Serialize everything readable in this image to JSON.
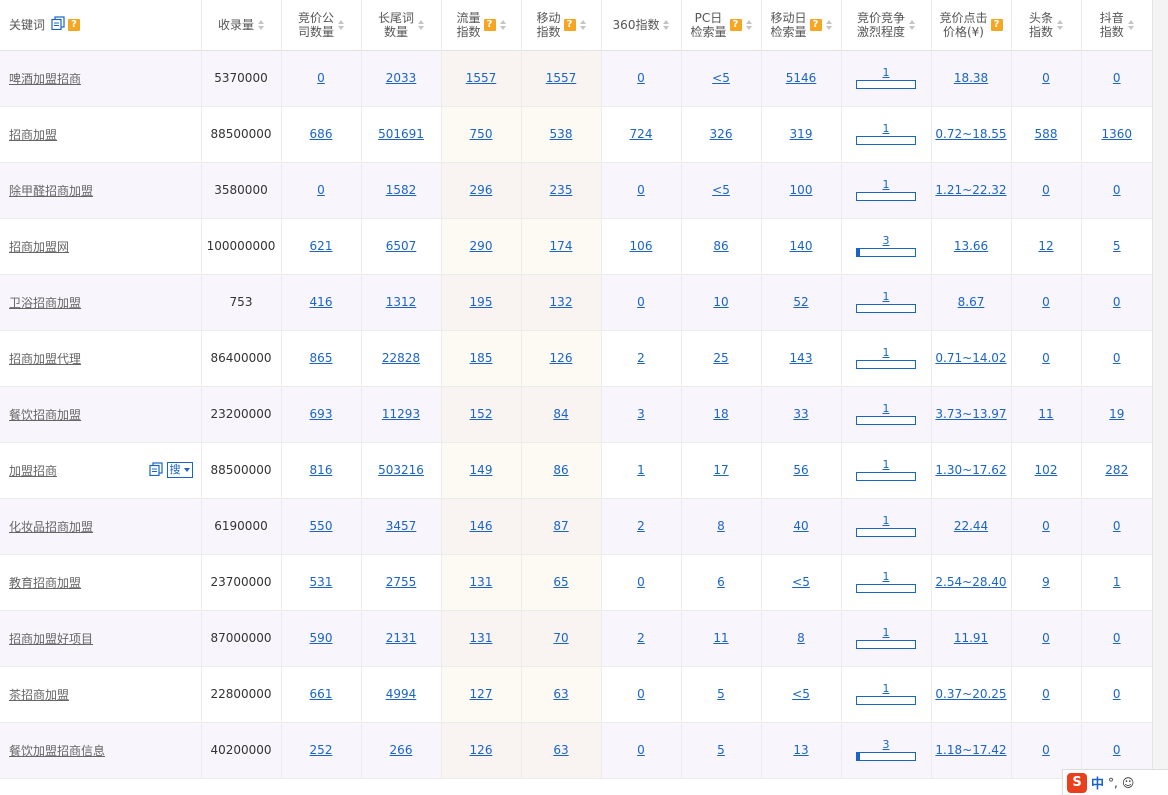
{
  "headers": {
    "keyword": "关键词",
    "indexed": "收录量",
    "bid_companies": [
      "竞价公",
      "司数量"
    ],
    "longtail": [
      "长尾词",
      "数量"
    ],
    "traffic": [
      "流量",
      "指数"
    ],
    "mobile": [
      "移动",
      "指数"
    ],
    "idx360": "360指数",
    "pc_daily": [
      "PC日",
      "检索量"
    ],
    "mobile_daily": [
      "移动日",
      "检索量"
    ],
    "competition": [
      "竞价竞争",
      "激烈程度"
    ],
    "cpc": [
      "竞价点击",
      "价格(¥)"
    ],
    "toutiao": [
      "头条",
      "指数"
    ],
    "douyin": [
      "抖音",
      "指数"
    ]
  },
  "icons": {
    "help": "?",
    "search_button": "搜"
  },
  "colors": {
    "link": "#1a64c8",
    "help_badge": "#f5a623"
  },
  "rows": [
    {
      "keyword": "啤酒加盟招商",
      "indexed": "5370000",
      "bid_companies": "0",
      "longtail": "2033",
      "traffic": "1557",
      "mobile": "1557",
      "idx360": "0",
      "pc_daily": "<5",
      "mobile_daily": "5146",
      "competition": "1",
      "cpc": "18.38",
      "toutiao": "0",
      "douyin": "0"
    },
    {
      "keyword": "招商加盟",
      "indexed": "88500000",
      "bid_companies": "686",
      "longtail": "501691",
      "traffic": "750",
      "mobile": "538",
      "idx360": "724",
      "pc_daily": "326",
      "mobile_daily": "319",
      "competition": "1",
      "cpc": "0.72~18.55",
      "toutiao": "588",
      "douyin": "1360"
    },
    {
      "keyword": "除甲醛招商加盟",
      "indexed": "3580000",
      "bid_companies": "0",
      "longtail": "1582",
      "traffic": "296",
      "mobile": "235",
      "idx360": "0",
      "pc_daily": "<5",
      "mobile_daily": "100",
      "competition": "1",
      "cpc": "1.21~22.32",
      "toutiao": "0",
      "douyin": "0"
    },
    {
      "keyword": "招商加盟网",
      "indexed": "100000000",
      "bid_companies": "621",
      "longtail": "6507",
      "traffic": "290",
      "mobile": "174",
      "idx360": "106",
      "pc_daily": "86",
      "mobile_daily": "140",
      "competition": "3",
      "cpc": "13.66",
      "toutiao": "12",
      "douyin": "5"
    },
    {
      "keyword": "卫浴招商加盟",
      "indexed": "753",
      "bid_companies": "416",
      "longtail": "1312",
      "traffic": "195",
      "mobile": "132",
      "idx360": "0",
      "pc_daily": "10",
      "mobile_daily": "52",
      "competition": "1",
      "cpc": "8.67",
      "toutiao": "0",
      "douyin": "0"
    },
    {
      "keyword": "招商加盟代理",
      "indexed": "86400000",
      "bid_companies": "865",
      "longtail": "22828",
      "traffic": "185",
      "mobile": "126",
      "idx360": "2",
      "pc_daily": "25",
      "mobile_daily": "143",
      "competition": "1",
      "cpc": "0.71~14.02",
      "toutiao": "0",
      "douyin": "0"
    },
    {
      "keyword": "餐饮招商加盟",
      "indexed": "23200000",
      "bid_companies": "693",
      "longtail": "11293",
      "traffic": "152",
      "mobile": "84",
      "idx360": "3",
      "pc_daily": "18",
      "mobile_daily": "33",
      "competition": "1",
      "cpc": "3.73~13.97",
      "toutiao": "11",
      "douyin": "19"
    },
    {
      "keyword": "加盟招商",
      "indexed": "88500000",
      "bid_companies": "816",
      "longtail": "503216",
      "traffic": "149",
      "mobile": "86",
      "idx360": "1",
      "pc_daily": "17",
      "mobile_daily": "56",
      "competition": "1",
      "cpc": "1.30~17.62",
      "toutiao": "102",
      "douyin": "282",
      "hovered": true
    },
    {
      "keyword": "化妆品招商加盟",
      "indexed": "6190000",
      "bid_companies": "550",
      "longtail": "3457",
      "traffic": "146",
      "mobile": "87",
      "idx360": "2",
      "pc_daily": "8",
      "mobile_daily": "40",
      "competition": "1",
      "cpc": "22.44",
      "toutiao": "0",
      "douyin": "0"
    },
    {
      "keyword": "教育招商加盟",
      "indexed": "23700000",
      "bid_companies": "531",
      "longtail": "2755",
      "traffic": "131",
      "mobile": "65",
      "idx360": "0",
      "pc_daily": "6",
      "mobile_daily": "<5",
      "competition": "1",
      "cpc": "2.54~28.40",
      "toutiao": "9",
      "douyin": "1"
    },
    {
      "keyword": "招商加盟好项目",
      "indexed": "87000000",
      "bid_companies": "590",
      "longtail": "2131",
      "traffic": "131",
      "mobile": "70",
      "idx360": "2",
      "pc_daily": "11",
      "mobile_daily": "8",
      "competition": "1",
      "cpc": "11.91",
      "toutiao": "0",
      "douyin": "0"
    },
    {
      "keyword": "茶招商加盟",
      "indexed": "22800000",
      "bid_companies": "661",
      "longtail": "4994",
      "traffic": "127",
      "mobile": "63",
      "idx360": "0",
      "pc_daily": "5",
      "mobile_daily": "<5",
      "competition": "1",
      "cpc": "0.37~20.25",
      "toutiao": "0",
      "douyin": "0"
    },
    {
      "keyword": "餐饮加盟招商信息",
      "indexed": "40200000",
      "bid_companies": "252",
      "longtail": "266",
      "traffic": "126",
      "mobile": "63",
      "idx360": "0",
      "pc_daily": "5",
      "mobile_daily": "13",
      "competition": "3",
      "cpc": "1.18~17.42",
      "toutiao": "0",
      "douyin": "0"
    }
  ],
  "ime": {
    "logo": "S",
    "mode": "中",
    "punct": "°,",
    "emoji": "☺"
  }
}
